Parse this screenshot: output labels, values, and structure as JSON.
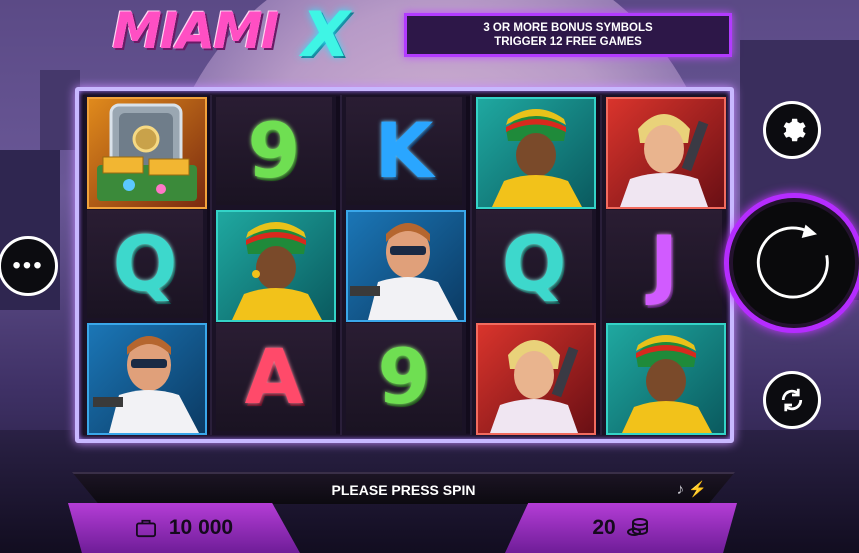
{
  "game": {
    "logo_main": "MIAMI",
    "logo_x": "X"
  },
  "banner": {
    "line1": "3 OR MORE BONUS SYMBOLS",
    "line2": "TRIGGER 12 FREE GAMES"
  },
  "reels": [
    [
      "bonus-vault",
      "Q",
      "detective"
    ],
    [
      "9",
      "rasta-lady",
      "A"
    ],
    [
      "K",
      "detective",
      "9"
    ],
    [
      "rasta-lady",
      "Q",
      "blonde-gunman"
    ],
    [
      "blonde-gunman",
      "J",
      "rasta-lady"
    ]
  ],
  "symbols": {
    "r0c1": "Q",
    "r1c0": "9",
    "r1c2": "A",
    "r2c0": "K",
    "r2c2": "9",
    "r3c1": "Q",
    "r4c1": "J"
  },
  "controls": {
    "settings_icon": "gear-icon",
    "menu_icon": "more-dots-icon",
    "spin_icon": "spin-arrow-icon",
    "autoplay_icon": "autoplay-icon",
    "menu_label": "•••"
  },
  "status": {
    "message": "PLEASE PRESS SPIN",
    "sound_icon": "music-note-icon",
    "turbo_icon": "lightning-icon"
  },
  "balance": {
    "icon": "briefcase-icon",
    "value": "10 000"
  },
  "bet": {
    "value": "20",
    "icon": "coins-icon"
  },
  "colors": {
    "accent_purple": "#b52cff",
    "banner_border": "#b23bff",
    "logo_pink": "#ff4fc3",
    "logo_cyan": "#3ff5e5"
  }
}
